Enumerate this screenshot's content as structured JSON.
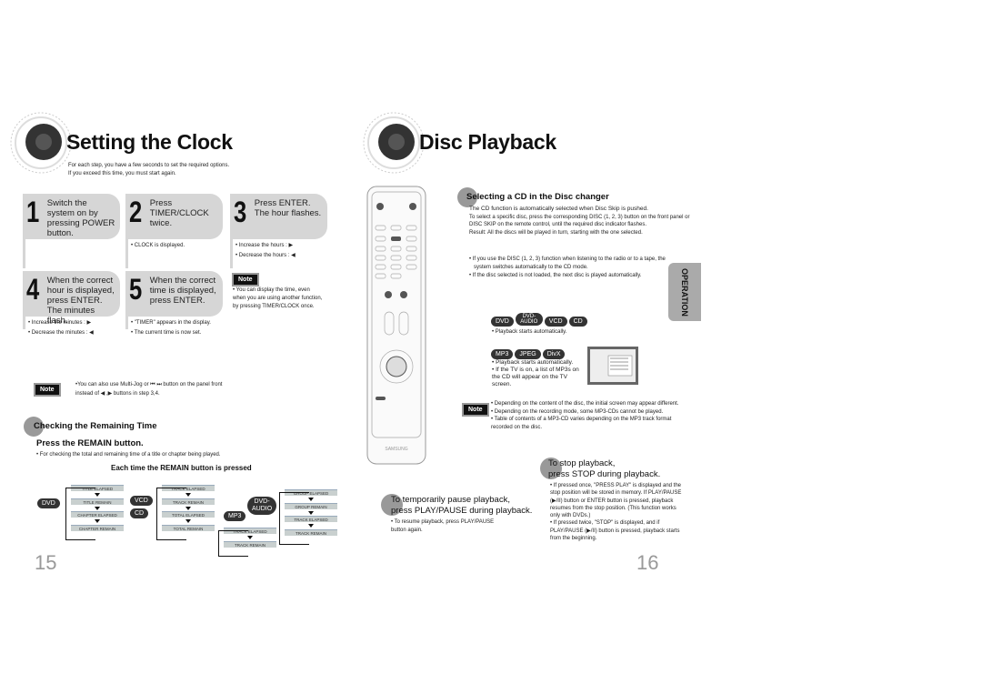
{
  "left": {
    "title": "Setting the Clock",
    "intro": [
      "For each step, you have a few seconds to set the required options.",
      "If you exceed this time, you must start again."
    ],
    "steps": [
      {
        "num": "1",
        "text": "Switch the system on by pressing POWER button.",
        "bullets": []
      },
      {
        "num": "2",
        "text": "Press TIMER/CLOCK twice.",
        "bullets": [
          "• CLOCK is displayed."
        ]
      },
      {
        "num": "3",
        "text": "Press ENTER. The hour flashes.",
        "bullets": [
          "• Increase the hours : ▶",
          "• Decrease the hours : ◀"
        ]
      },
      {
        "num": "4",
        "text": "When the correct hour is displayed, press ENTER. The minutes flash.",
        "bullets": [
          "• Increase the minutes : ▶",
          "• Decrease the minutes : ◀"
        ]
      },
      {
        "num": "5",
        "text": "When the correct time is displayed, press ENTER.",
        "bullets": [
          "• \"TIMER\" appears in the display.",
          "• The current time is now set."
        ]
      }
    ],
    "note_label": "Note",
    "note_text": "• You can display the time, even when you are using another function, by pressing TIMER/CLOCK once.",
    "note2_label": "Note",
    "note2_lines": [
      "•You can also use Multi-Jog or ⏮ ⏭ button on the panel front",
      "instead of ◀ ,▶ buttons in step 3,4."
    ],
    "section_title": "Checking the Remaining Time",
    "section_sub": "Press the REMAIN button.",
    "section_bullet": "• For checking the total and remaining time of a title or chapter being played.",
    "diagram_title": "Each time the REMAIN button is pressed",
    "groups": [
      {
        "discs": [
          "DVD"
        ],
        "items": [
          "TITLE ELAPSED",
          "TITLE REMAIN",
          "CHAPTER ELAPSED",
          "CHAPTER REMAIN"
        ]
      },
      {
        "discs": [
          "VCD",
          "CD"
        ],
        "items": [
          "TRACK ELAPSED",
          "TRACK REMAIN",
          "TOTAL ELAPSED",
          "TOTAL REMAIN"
        ]
      },
      {
        "discs": [
          "MP3"
        ],
        "items": [
          "TRACK ELAPSED",
          "TRACK REMAIN"
        ]
      },
      {
        "discs": [
          "DVD-AUDIO"
        ],
        "items": [
          "GROUP ELAPSED",
          "GROUP REMAIN",
          "TRACK ELAPSED",
          "TRACK REMAIN"
        ]
      }
    ],
    "page": "15"
  },
  "right": {
    "title": "Disc Playback",
    "remote_brand": "SAMSUNG",
    "sel_title": "Selecting a CD in the Disc changer",
    "sel_lines": [
      "The CD function is automatically selected when Disc Skip is pushed.",
      "To select a specific disc, press the corresponding DISC (1, 2, 3) button on the front panel or",
      "DISC SKIP on the remote control, until the required disc indicator flashes.",
      "Result: All the discs will be played in turn, starting with the one selected."
    ],
    "sel_bullets": [
      "• If you use the DISC (1, 2, 3) function when listening to the radio or to a tape, the",
      "system switches automatically to the CD mode.",
      "• If the disc selected is not loaded, the next disc is played automatically."
    ],
    "tab": "OPERATION",
    "discs1": [
      "DVD",
      "DVD-AUDIO",
      "VCD",
      "CD"
    ],
    "discs1_bullet": "• Playback starts automatically.",
    "discs2": [
      "MP3",
      "JPEG",
      "DivX"
    ],
    "discs2_bullets": [
      "• Playback starts automatically.",
      "• If the TV is on, a list of MP3s on the CD will appear on the TV screen."
    ],
    "note_label": "Note",
    "notes": [
      "• Depending on the content of the disc, the initial screen may appear different.",
      "• Depending on the recording mode, some MP3-CDs cannot be played.",
      "• Table of contents of a MP3-CD varies depending on the MP3 track format recorded on the disc."
    ],
    "stop_title": [
      "To stop playback,",
      "press STOP during playback."
    ],
    "stop_bullets": [
      "• If pressed once, \"PRESS PLAY\" is displayed and the stop position will be stored in memory. If PLAY/PAUSE (▶/II) button or ENTER button is pressed, playback resumes from the stop position. (This function works only with DVDs.)",
      "• If pressed twice, \"STOP\" is displayed, and if PLAY/PAUSE (▶/II) button is pressed, playback starts from the beginning."
    ],
    "pause_title": [
      "To temporarily pause playback,",
      "press PLAY/PAUSE during playback."
    ],
    "pause_bullet": "• To resume playback, press PLAY/PAUSE button again.",
    "page": "16"
  }
}
